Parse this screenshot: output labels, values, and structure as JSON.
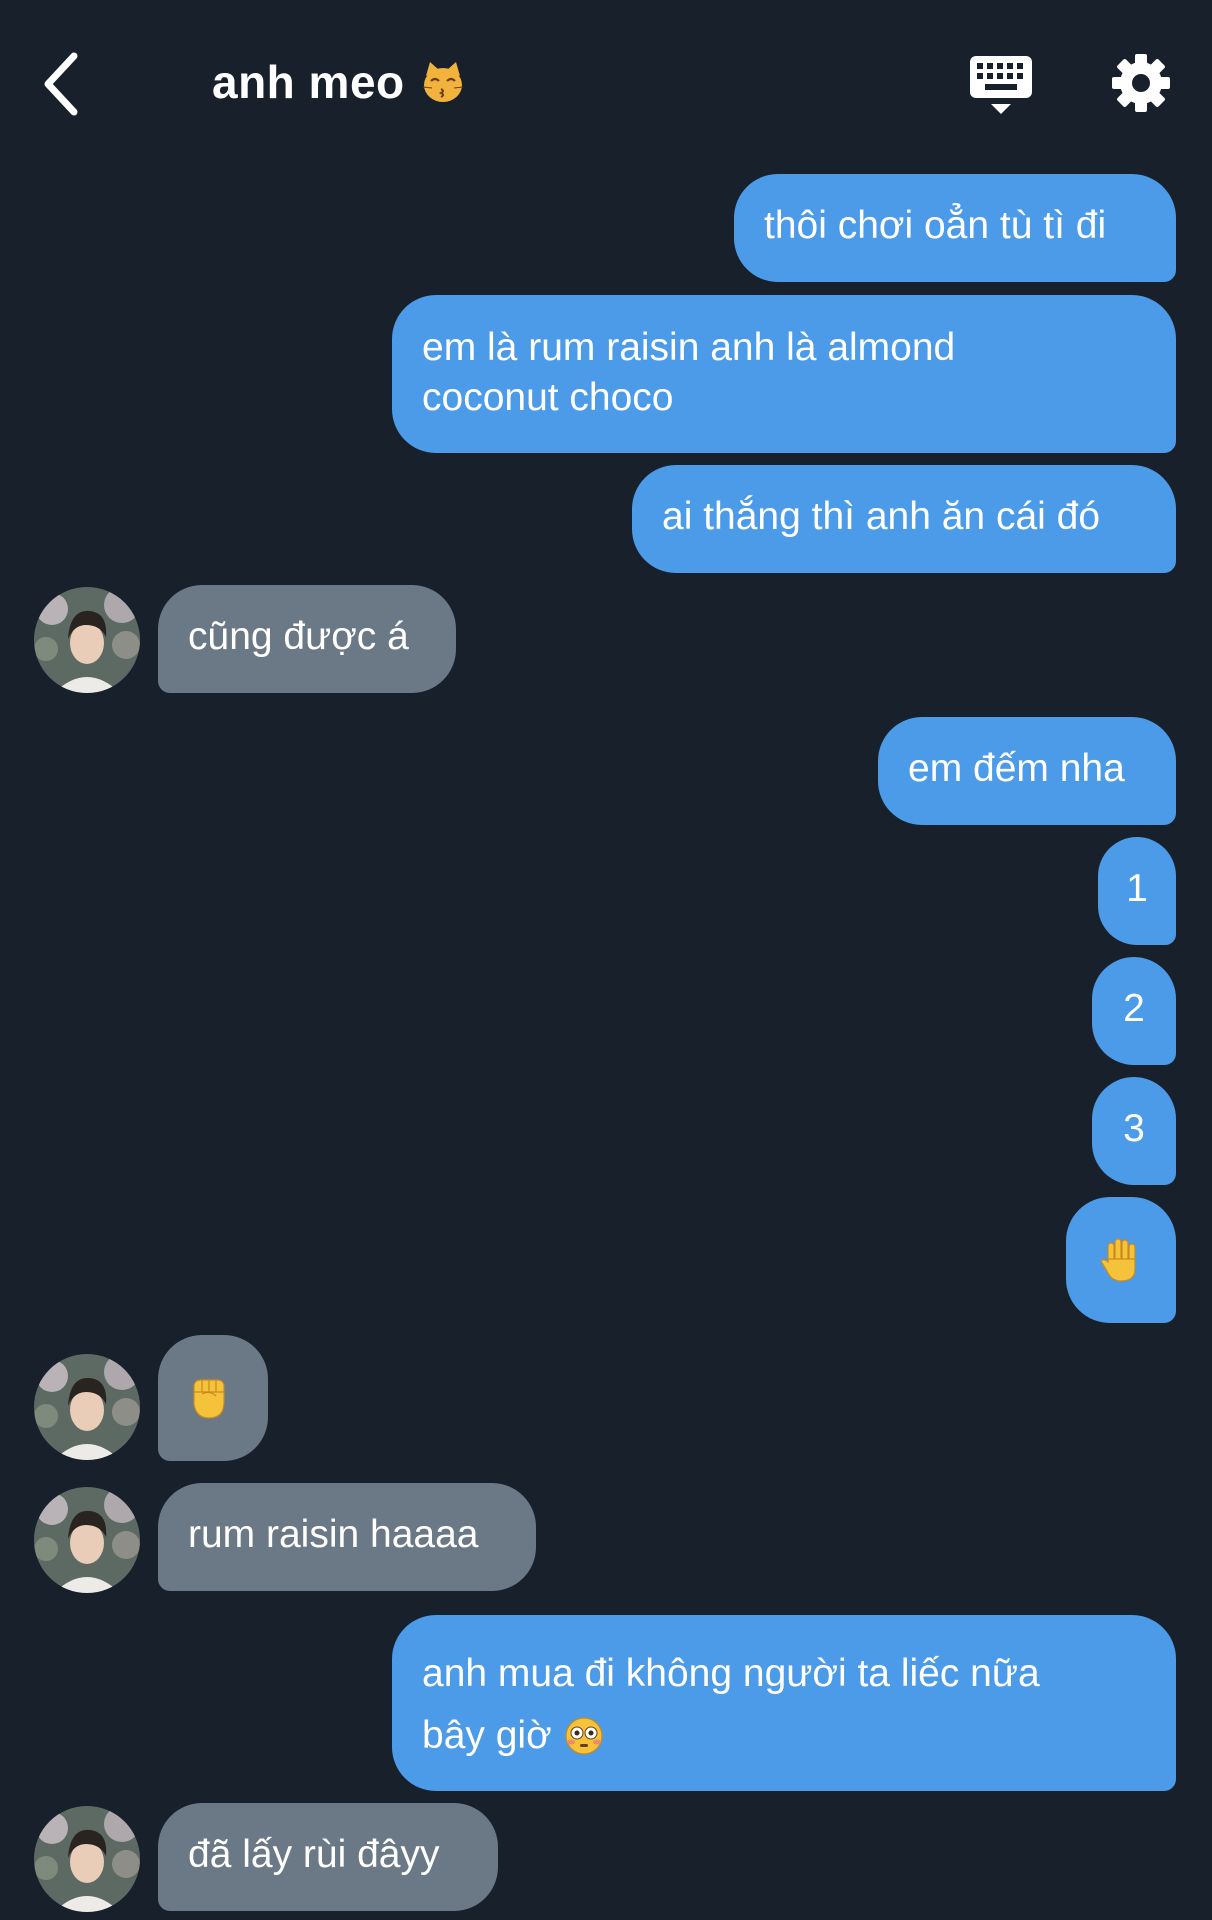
{
  "header": {
    "title": "anh meo",
    "title_emoji_icon": "kissing-cat-icon",
    "back_icon": "chevron-left-icon",
    "keyboard_icon": "keyboard-icon",
    "settings_icon": "gear-icon"
  },
  "colors": {
    "background": "#18202b",
    "sent_bubble": "#4c9be8",
    "received_bubble": "#6b7886",
    "text": "#ffffff"
  },
  "messages": [
    {
      "from": "me",
      "text": "thôi chơi oẳn tù tì đi"
    },
    {
      "from": "me",
      "lines": [
        "em là rum raisin anh là almond",
        "coconut choco"
      ]
    },
    {
      "from": "me",
      "text": "ai thắng thì anh ăn cái đó"
    },
    {
      "from": "them",
      "text": "cũng được á"
    },
    {
      "from": "me",
      "text": "em đếm nha"
    },
    {
      "from": "me",
      "text": "1"
    },
    {
      "from": "me",
      "text": "2"
    },
    {
      "from": "me",
      "text": "3"
    },
    {
      "from": "me",
      "emoji": "raised-hand-icon"
    },
    {
      "from": "them",
      "emoji": "raised-fist-icon"
    },
    {
      "from": "them",
      "text": "rum raisin haaaa"
    },
    {
      "from": "me",
      "lines": [
        "anh mua đi không người ta liếc nữa",
        "bây giờ"
      ],
      "trailing_emoji": "flushed-face-icon"
    },
    {
      "from": "them",
      "text": "đã lấy rùi đâyy"
    }
  ]
}
